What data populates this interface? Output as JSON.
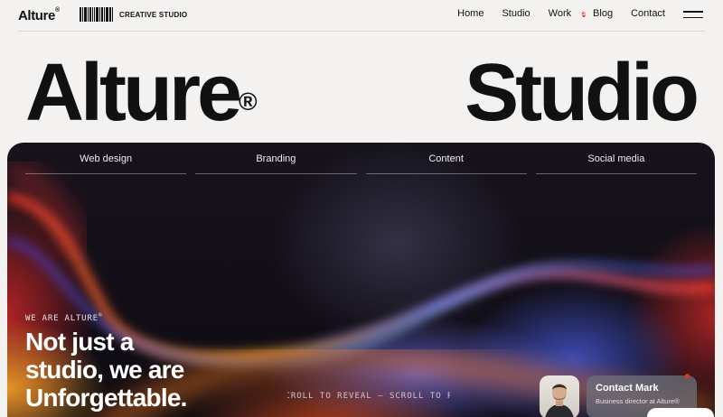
{
  "header": {
    "logo": "Alture",
    "logo_mark": "®",
    "tagline": "CREATIVE STUDIO",
    "nav": [
      {
        "label": "Home"
      },
      {
        "label": "Studio"
      },
      {
        "label": "Work",
        "badge": "3"
      },
      {
        "label": "Blog"
      },
      {
        "label": "Contact"
      }
    ],
    "menu_icon": "hamburger-menu-icon"
  },
  "hero": {
    "left_word": "Alture",
    "left_mark": "®",
    "right_word": "Studio"
  },
  "services": [
    "Web design",
    "Branding",
    "Content",
    "Social media"
  ],
  "intro": {
    "eyebrow": "WE ARE ALTURE",
    "eyebrow_mark": "®",
    "headline_lines": [
      "Not just a",
      "studio, we are",
      "Unforgettable."
    ],
    "scroll_text": "SCROLL TO REVEAL — SCROLL TO REVEAL"
  },
  "contact": {
    "name": "Contact Mark",
    "role": "Business director at Alture®"
  },
  "colors": {
    "background": "#f3f2f0",
    "text": "#111111",
    "badge": "#e5341d",
    "panel_dark": "#120e17"
  }
}
